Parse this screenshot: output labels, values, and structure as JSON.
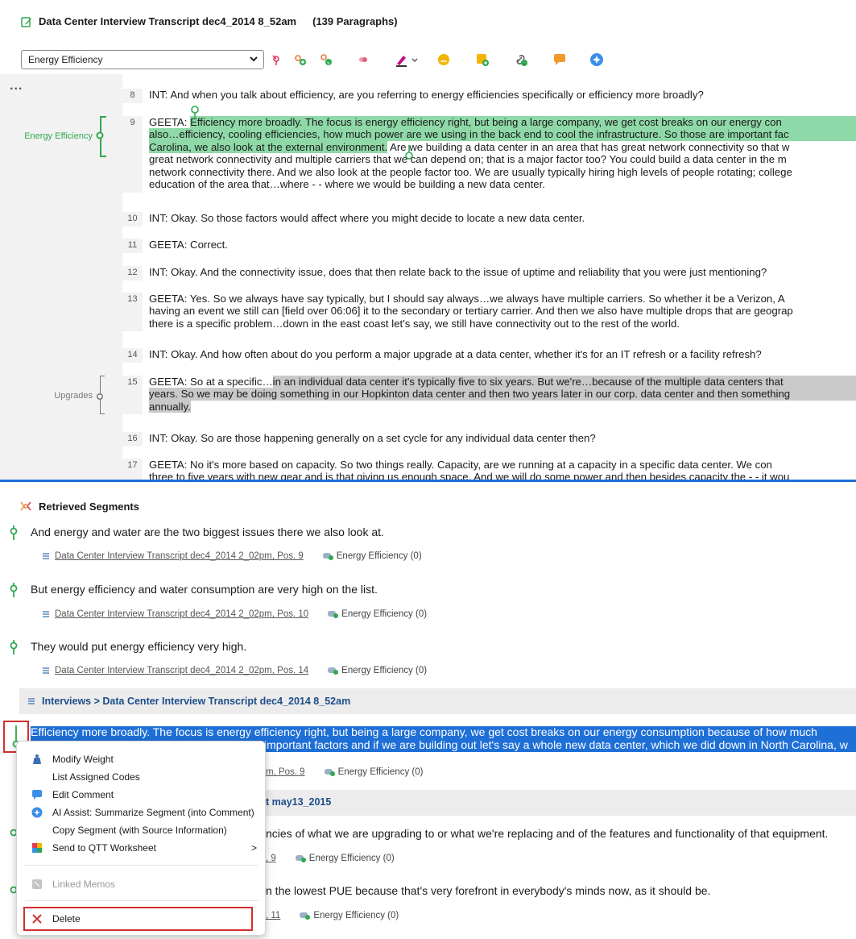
{
  "header": {
    "title": "Data Center Interview Transcript dec4_2014 8_52am",
    "paragraph_count": "(139 Paragraphs)"
  },
  "toolbar": {
    "code_selected": "Energy Efficiency"
  },
  "document": {
    "ellipsis": "...",
    "margin_codes": [
      "Energy Efficiency",
      "Upgrades"
    ],
    "paragraphs": [
      {
        "num": "8",
        "lines": [
          "INT:  And when you talk about efficiency, are you referring to energy efficiencies specifically or efficiency more broadly?"
        ]
      },
      {
        "num": "9",
        "prefix": "GEETA:  ",
        "lines": [
          "Efficiency more broadly.  The focus is energy efficiency right, but being a large company, we get cost breaks on our energy con",
          "also…efficiency, cooling efficiencies, how much power are we using in the back end to cool the infrastructure. So those are important fac",
          "Carolina, we also look at the external environment.",
          "  Are we building a data center in an area that has great network connectivity so that w",
          "great network connectivity and multiple carriers that we can depend on; that is a major factor too?  You could build a data center in the m",
          "network connectivity there.  And we also look at the people factor too.  We are usually typically hiring high levels of people rotating; college",
          "education of the area that…where - - where we would be building a new data center."
        ]
      },
      {
        "num": "10",
        "lines": [
          "INT:  Okay.  So those factors would affect where you might decide to locate a new data center."
        ]
      },
      {
        "num": "11",
        "lines": [
          "GEETA:  Correct."
        ]
      },
      {
        "num": "12",
        "lines": [
          "INT:  Okay. And the connectivity issue, does that then relate back to the issue of uptime and reliability that you were just mentioning?"
        ]
      },
      {
        "num": "13",
        "lines": [
          "GEETA:  Yes.  So we always have say typically, but I should say always…we always have multiple carriers. So whether it be a Verizon, A",
          "having an event we still can [field over 06:06] it to the secondary or tertiary carrier. And then we also have multiple drops that are geograp",
          "there is a specific problem…down in the east coast let's say, we still have connectivity out to the rest of the world."
        ]
      },
      {
        "num": "14",
        "lines": [
          "INT:  Okay.  And how often about do you perform a major upgrade at a data center, whether it's for an IT refresh or a facility refresh?"
        ]
      },
      {
        "num": "15",
        "prefix": "GEETA:  So at a specific…",
        "lines": [
          "in an individual data center it's typically five to six years.  But we're…because of the multiple data centers that",
          "years.  So we may be doing something in our Hopkinton data center and then two years later in our corp. data center and then something",
          "annually."
        ]
      },
      {
        "num": "16",
        "lines": [
          "INT:  Okay.  So are those happening generally on a set cycle for any individual data center then?"
        ]
      },
      {
        "num": "17",
        "lines": [
          "GEETA:  No it's more based on capacity.   So two things really.  Capacity, are we running at a capacity in a specific data center.  We con",
          "three to five years with new gear and is that giving us enough space. And we will do some power and then besides capacity the - - it wou"
        ]
      }
    ]
  },
  "retrieved": {
    "title": "Retrieved Segments",
    "segments": [
      {
        "text": "And energy and water are the two biggest issues there we also look at.",
        "source": "Data Center Interview Transcript dec4_2014 2_02pm, Pos. 9",
        "code": "Energy Efficiency (0)"
      },
      {
        "text": "But energy efficiency and water consumption are very high on the list.",
        "source": "Data Center Interview Transcript dec4_2014 2_02pm, Pos. 10",
        "code": "Energy Efficiency (0)"
      },
      {
        "text": "They would put energy efficiency very high.",
        "source": "Data Center Interview Transcript dec4_2014 2_02pm, Pos. 14",
        "code": "Energy Efficiency (0)"
      }
    ],
    "group_label": "Interviews > Data Center Interview Transcript dec4_2014 8_52am",
    "selected_segment": {
      "line1": "Efficiency more broadly.  The focus is energy efficiency right, but being a large company, we get cost breaks on our energy consumption because of how much",
      "line2": "important factors and if we are building out let's say a whole new data center, which we did down in North Carolina, w",
      "source_tail": "m, Pos. 9",
      "code": "Energy Efficiency (0)"
    },
    "group2_tail": "t may13_2015",
    "segment_after_1": {
      "text": "ncies of what we are upgrading to or what we're replacing and of the features and functionality of that equipment.",
      "source_tail": ", 9",
      "code": "Energy Efficiency (0)"
    },
    "segment_after_2": {
      "text": "n the lowest PUE because that's very forefront in everybody's minds now, as it should be.",
      "source_tail": ", 11",
      "code": "Energy Efficiency (0)"
    }
  },
  "context_menu": {
    "items": [
      {
        "label": "Modify Weight",
        "icon": "weight-icon"
      },
      {
        "label": "List Assigned Codes",
        "icon": ""
      },
      {
        "label": "Edit Comment",
        "icon": "comment-icon"
      },
      {
        "label": "AI Assist: Summarize Segment (into Comment)",
        "icon": "ai-assist-icon"
      },
      {
        "label": "Copy Segment (with Source Information)",
        "icon": ""
      },
      {
        "label": "Send to QTT Worksheet",
        "icon": "qtt-icon",
        "submenu": ">"
      },
      {
        "label": "Linked Memos",
        "icon": "memo-icon",
        "disabled": true
      },
      {
        "label": "Delete",
        "icon": "delete-icon"
      }
    ]
  },
  "colors": {
    "accent_blue": "#1e6fd6",
    "code_green": "#2fa84f",
    "highlight_green": "#8fd9a8",
    "highlight_grey": "#c9c9c9",
    "delete_red": "#d32f2f"
  }
}
